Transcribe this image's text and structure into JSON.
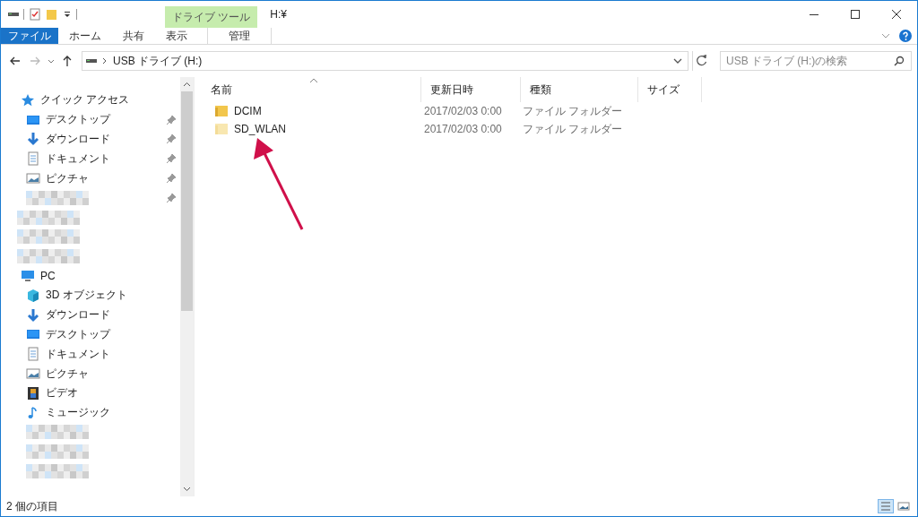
{
  "window": {
    "title": "H:¥",
    "context_group": "ドライブ ツール"
  },
  "ribbon_tabs": [
    {
      "label": "ファイル",
      "kind": "file",
      "selected": false
    },
    {
      "label": "ホーム",
      "kind": "tab",
      "selected": false
    },
    {
      "label": "共有",
      "kind": "tab",
      "selected": false
    },
    {
      "label": "表示",
      "kind": "tab",
      "selected": false
    },
    {
      "label": "管理",
      "kind": "context",
      "selected": false
    }
  ],
  "address": {
    "path": "USB ドライブ (H:)"
  },
  "search": {
    "placeholder": "USB ドライブ (H:)の検索"
  },
  "sidebar": {
    "items": [
      {
        "kind": "quick",
        "label": "クイック アクセス",
        "pinned": false,
        "children": [
          {
            "kind": "desktop",
            "label": "デスクトップ",
            "pinned": true
          },
          {
            "kind": "download",
            "label": "ダウンロード",
            "pinned": true
          },
          {
            "kind": "document",
            "label": "ドキュメント",
            "pinned": true
          },
          {
            "kind": "picture",
            "label": "ピクチャ",
            "pinned": true
          },
          {
            "kind": "redacted",
            "pinned": true
          }
        ]
      },
      {
        "kind": "redacted",
        "pinned": false
      },
      {
        "kind": "redacted",
        "pinned": false
      },
      {
        "kind": "redacted",
        "pinned": false
      },
      {
        "kind": "pc",
        "label": "PC",
        "pinned": false,
        "children": [
          {
            "kind": "cube",
            "label": "3D オブジェクト",
            "pinned": false
          },
          {
            "kind": "download",
            "label": "ダウンロード",
            "pinned": false
          },
          {
            "kind": "desktop",
            "label": "デスクトップ",
            "pinned": false
          },
          {
            "kind": "document",
            "label": "ドキュメント",
            "pinned": false
          },
          {
            "kind": "picture",
            "label": "ピクチャ",
            "pinned": false
          },
          {
            "kind": "video",
            "label": "ビデオ",
            "pinned": false
          },
          {
            "kind": "music",
            "label": "ミュージック",
            "pinned": false
          },
          {
            "kind": "redacted",
            "pinned": false
          },
          {
            "kind": "redacted",
            "pinned": false
          },
          {
            "kind": "redacted",
            "pinned": false
          }
        ]
      }
    ]
  },
  "table": {
    "columns": [
      "名前",
      "更新日時",
      "種類",
      "サイズ"
    ],
    "rows": [
      {
        "name": "DCIM",
        "modified": "2017/02/03 0:00",
        "type": "ファイル フォルダー",
        "hidden": false
      },
      {
        "name": "SD_WLAN",
        "modified": "2017/02/03 0:00",
        "type": "ファイル フォルダー",
        "hidden": true
      }
    ]
  },
  "status_bar": {
    "count": "2 個の項目",
    "view_buttons": [
      {
        "kind": "details",
        "selected": true
      },
      {
        "kind": "icons",
        "selected": false
      }
    ]
  }
}
